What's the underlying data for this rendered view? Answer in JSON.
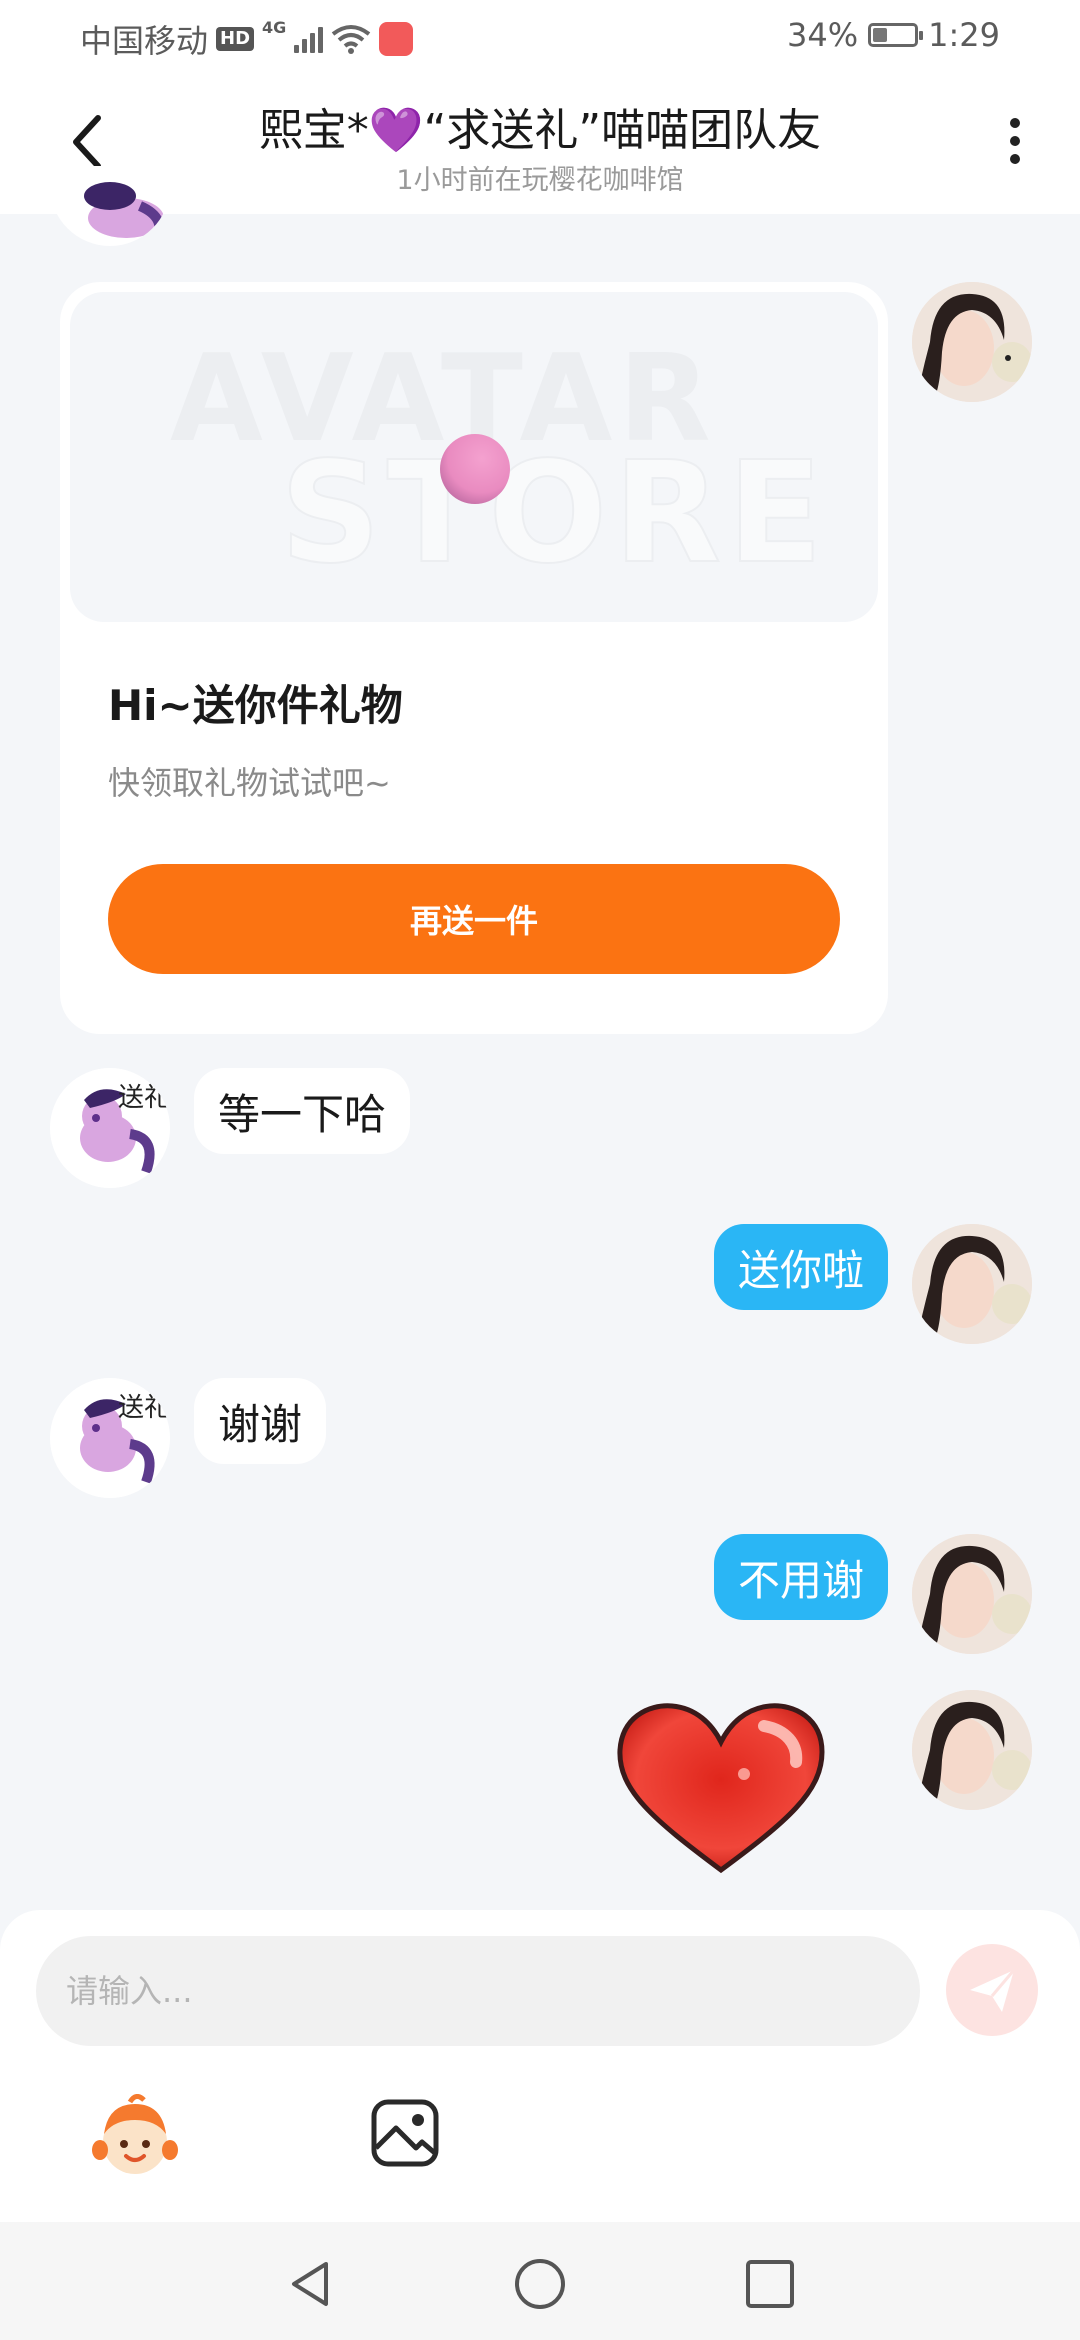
{
  "status_bar": {
    "carrier": "中国移动",
    "hd": "HD",
    "network": "4G",
    "battery": "34%",
    "battery_level": 0.34,
    "time": "1:29"
  },
  "header": {
    "title": "熙宝*💜“求送礼”喵喵团队友",
    "subtitle": "1小时前在玩樱花咖啡馆"
  },
  "gift_card": {
    "watermark_top": "AVATAR",
    "watermark_bottom": "STORE",
    "title": "Hi~送你件礼物",
    "description": "快领取礼物试试吧~",
    "button_label": "再送一件"
  },
  "friend_avatar_text": "送礼",
  "messages": [
    {
      "from": "friend",
      "text": "等一下哈"
    },
    {
      "from": "me",
      "text": "送你啦"
    },
    {
      "from": "friend",
      "text": "谢谢"
    },
    {
      "from": "me",
      "text": "不用谢"
    },
    {
      "from": "me",
      "sticker": "heart"
    }
  ],
  "composer": {
    "placeholder": "请输入..."
  },
  "colors": {
    "accent_orange": "#fb7312",
    "bubble_out": "#2ab6f5",
    "background": "#f4f6f9"
  },
  "icons": {
    "back": "chevron-left-icon",
    "more": "more-vertical-icon",
    "send": "paper-plane-icon",
    "emoji": "emoji-face-icon",
    "image": "image-icon",
    "nav_back": "triangle-back-icon",
    "nav_home": "circle-home-icon",
    "nav_recent": "square-recent-icon"
  }
}
